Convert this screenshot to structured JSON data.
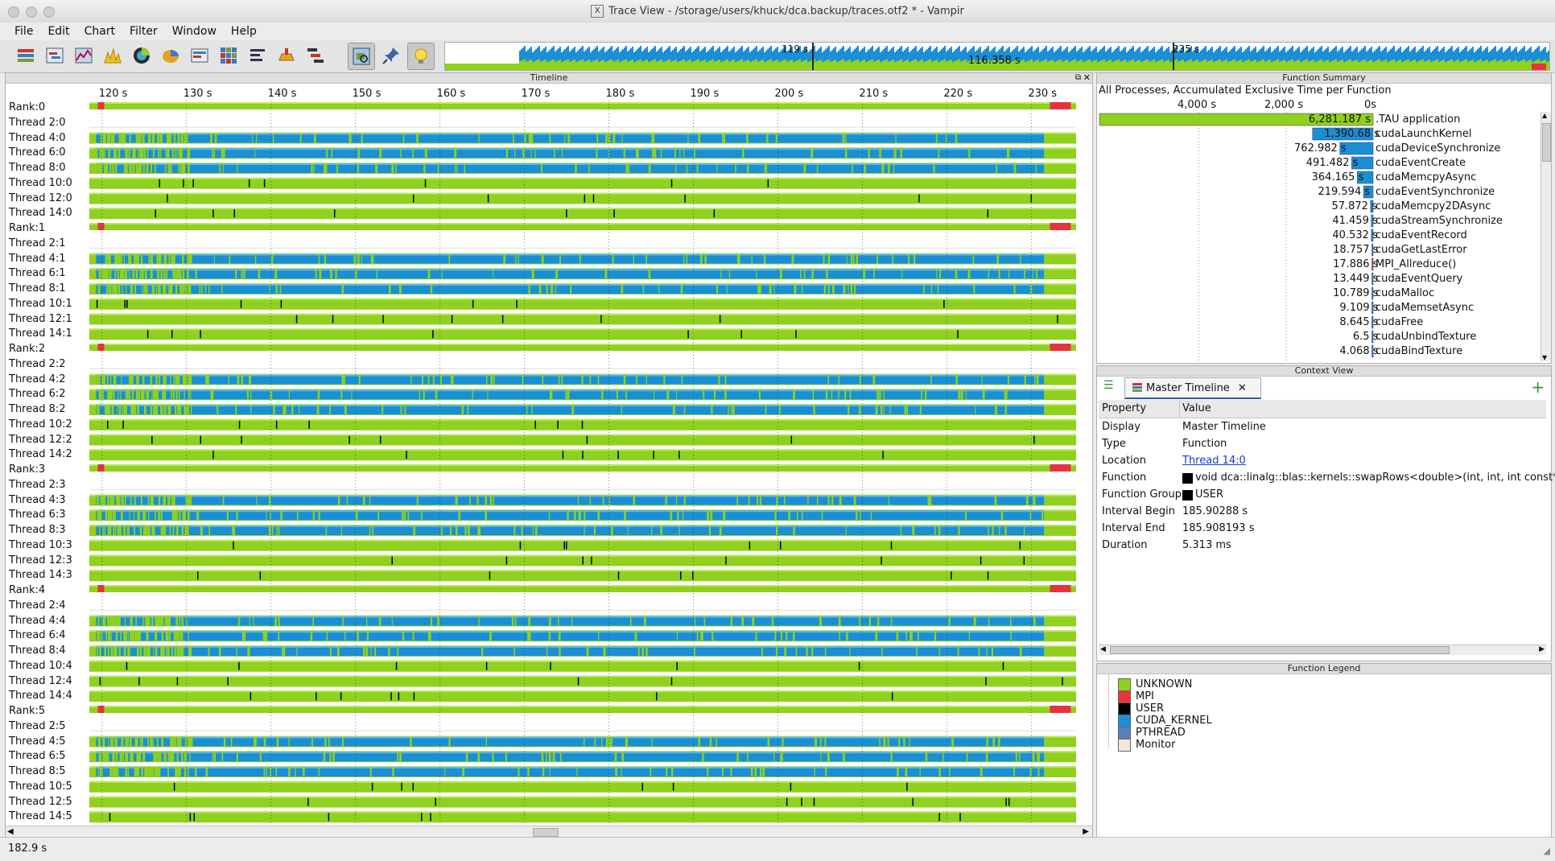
{
  "window": {
    "title": "Trace View - /storage/users/khuck/dca.backup/traces.otf2 * - Vampir"
  },
  "menu": [
    "File",
    "Edit",
    "Chart",
    "Filter",
    "Window",
    "Help"
  ],
  "toolbar": {
    "icons": [
      "master-timeline-icon",
      "process-timeline-icon",
      "counter-timeline-icon",
      "performance-radar-icon",
      "function-summary-icon",
      "process-summary-icon",
      "message-summary-icon",
      "communication-matrix-icon",
      "io-summary-icon",
      "call-tree-icon",
      "zoom-mode-icon",
      "pin-icon",
      "lightbulb-icon"
    ],
    "overview_labels": {
      "left": "119 s",
      "center": "116.358 s",
      "right": "235 s"
    }
  },
  "timeline": {
    "title": "Timeline",
    "ticks": [
      "120 s",
      "130 s",
      "140 s",
      "150 s",
      "160 s",
      "170 s",
      "180 s",
      "190 s",
      "200 s",
      "210 s",
      "220 s",
      "230 s"
    ],
    "rows": [
      "Rank:0",
      "Thread 2:0",
      "Thread 4:0",
      "Thread 6:0",
      "Thread 8:0",
      "Thread 10:0",
      "Thread 12:0",
      "Thread 14:0",
      "Rank:1",
      "Thread 2:1",
      "Thread 4:1",
      "Thread 6:1",
      "Thread 8:1",
      "Thread 10:1",
      "Thread 12:1",
      "Thread 14:1",
      "Rank:2",
      "Thread 2:2",
      "Thread 4:2",
      "Thread 6:2",
      "Thread 8:2",
      "Thread 10:2",
      "Thread 12:2",
      "Thread 14:2",
      "Rank:3",
      "Thread 2:3",
      "Thread 4:3",
      "Thread 6:3",
      "Thread 8:3",
      "Thread 10:3",
      "Thread 12:3",
      "Thread 14:3",
      "Rank:4",
      "Thread 2:4",
      "Thread 4:4",
      "Thread 6:4",
      "Thread 8:4",
      "Thread 10:4",
      "Thread 12:4",
      "Thread 14:4",
      "Rank:5",
      "Thread 2:5",
      "Thread 4:5",
      "Thread 6:5",
      "Thread 8:5",
      "Thread 10:5",
      "Thread 12:5",
      "Thread 14:5"
    ]
  },
  "function_summary": {
    "title": "Function Summary",
    "subtitle": "All Processes, Accumulated Exclusive Time per Function",
    "axis": [
      "4,000 s",
      "2,000 s",
      "0s"
    ],
    "rows": [
      {
        "value": "6,281.187 s",
        "name": ".TAU application",
        "seconds": 6281.187,
        "group": "UNKNOWN"
      },
      {
        "value": "1,390.68 s",
        "name": "cudaLaunchKernel",
        "seconds": 1390.68,
        "group": "CUDA_KERNEL"
      },
      {
        "value": "762.982 s",
        "name": "cudaDeviceSynchronize",
        "seconds": 762.982,
        "group": "CUDA_KERNEL"
      },
      {
        "value": "491.482 s",
        "name": "cudaEventCreate",
        "seconds": 491.482,
        "group": "CUDA_KERNEL"
      },
      {
        "value": "364.165 s",
        "name": "cudaMemcpyAsync",
        "seconds": 364.165,
        "group": "CUDA_KERNEL"
      },
      {
        "value": "219.594 s",
        "name": "cudaEventSynchronize",
        "seconds": 219.594,
        "group": "CUDA_KERNEL"
      },
      {
        "value": "57.872 s",
        "name": "cudaMemcpy2DAsync",
        "seconds": 57.872,
        "group": "CUDA_KERNEL"
      },
      {
        "value": "41.459 s",
        "name": "cudaStreamSynchronize",
        "seconds": 41.459,
        "group": "CUDA_KERNEL"
      },
      {
        "value": "40.532 s",
        "name": "cudaEventRecord",
        "seconds": 40.532,
        "group": "CUDA_KERNEL"
      },
      {
        "value": "18.757 s",
        "name": "cudaGetLastError",
        "seconds": 18.757,
        "group": "CUDA_KERNEL"
      },
      {
        "value": "17.886 s",
        "name": "MPI_Allreduce()",
        "seconds": 17.886,
        "group": "MPI"
      },
      {
        "value": "13.449 s",
        "name": "cudaEventQuery",
        "seconds": 13.449,
        "group": "CUDA_KERNEL"
      },
      {
        "value": "10.789 s",
        "name": "cudaMalloc",
        "seconds": 10.789,
        "group": "CUDA_KERNEL"
      },
      {
        "value": "9.109 s",
        "name": "cudaMemsetAsync",
        "seconds": 9.109,
        "group": "CUDA_KERNEL"
      },
      {
        "value": "8.645 s",
        "name": "cudaFree",
        "seconds": 8.645,
        "group": "CUDA_KERNEL"
      },
      {
        "value": "6.5 s",
        "name": "cudaUnbindTexture",
        "seconds": 6.5,
        "group": "CUDA_KERNEL"
      },
      {
        "value": "4.068 s",
        "name": "cudaBindTexture",
        "seconds": 4.068,
        "group": "CUDA_KERNEL"
      }
    ]
  },
  "context_view": {
    "title": "Context View",
    "tab_label": "Master Timeline",
    "header": {
      "property": "Property",
      "value": "Value"
    },
    "rows": [
      {
        "property": "Display",
        "value": "Master Timeline"
      },
      {
        "property": "Type",
        "value": "Function"
      },
      {
        "property": "Location",
        "value": "Thread 14:0"
      },
      {
        "property": "Function",
        "value": "void dca::linalg::blas::kernels::swapRows<double>(int, int, int const*,"
      },
      {
        "property": "Function Group",
        "value": "USER"
      },
      {
        "property": "Interval Begin",
        "value": "185.90288 s"
      },
      {
        "property": "Interval End",
        "value": "185.908193 s"
      },
      {
        "property": "Duration",
        "value": "5.313 ms"
      }
    ]
  },
  "function_legend": {
    "title": "Function Legend",
    "items": [
      {
        "name": "UNKNOWN",
        "color": "#8fd11e"
      },
      {
        "name": "MPI",
        "color": "#e8323c"
      },
      {
        "name": "USER",
        "color": "#000000"
      },
      {
        "name": "CUDA_KERNEL",
        "color": "#1a8fd6"
      },
      {
        "name": "PTHREAD",
        "color": "#5a7fbf"
      },
      {
        "name": "Monitor",
        "color": "#f1e9dc"
      }
    ]
  },
  "status": {
    "time": "182.9 s"
  },
  "colors": {
    "unknown": "#8fd11e",
    "cuda": "#1a8fd6",
    "mpi": "#e8323c",
    "user": "#000000"
  }
}
